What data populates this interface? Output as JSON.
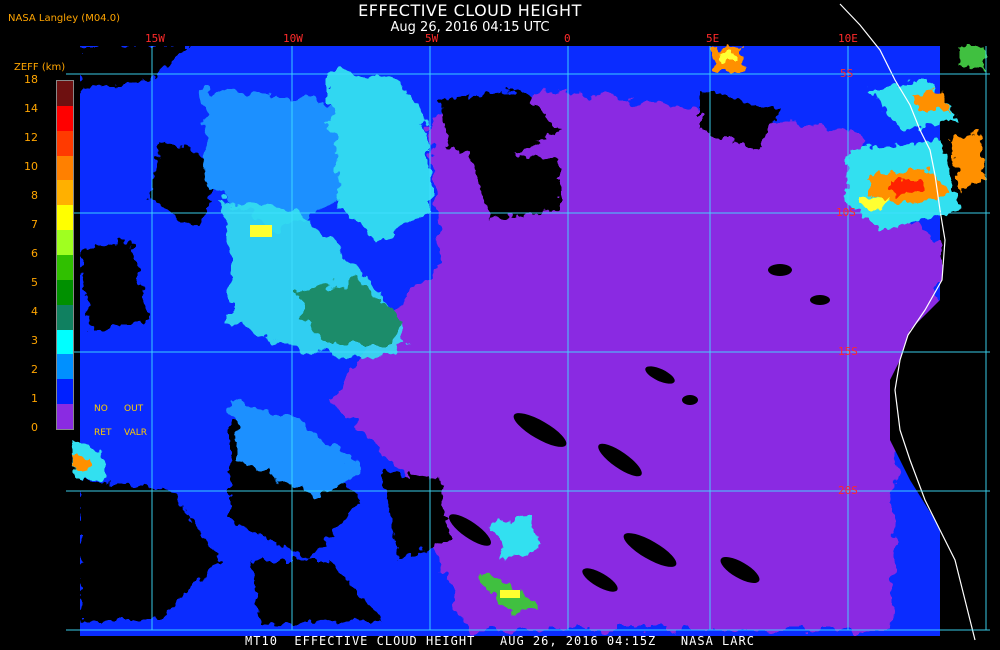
{
  "header": {
    "title": "EFFECTIVE CLOUD HEIGHT",
    "subtitle": "Aug 26, 2016 04:15 UTC",
    "credit": "NASA Langley (M04.0)"
  },
  "footer": {
    "text": "MT10  EFFECTIVE CLOUD HEIGHT   AUG 26, 2016 04:15Z   NASA LARC"
  },
  "map": {
    "lon_labels": [
      "15W",
      "10W",
      "5W",
      "0",
      "5E",
      "10E"
    ],
    "lat_labels": [
      "5S",
      "10S",
      "15S",
      "20S"
    ],
    "grid_color": "#40e0ff",
    "label_color": "#ff2a2a",
    "coast_color": "#ffffff"
  },
  "colorbar": {
    "title": "ZEFF (km)",
    "ticks": [
      "18",
      "14",
      "12",
      "10",
      "8",
      "7",
      "6",
      "5",
      "4",
      "3",
      "2",
      "1",
      "0"
    ],
    "colors": [
      "#6e1010",
      "#ff0000",
      "#ff3a00",
      "#ff8000",
      "#ffb000",
      "#ffff00",
      "#a0ff20",
      "#30c000",
      "#009000",
      "#108060",
      "#00ffff",
      "#0090ff",
      "#0020ff",
      "#8a2be2"
    ],
    "no_retrieval_label_1": "NO",
    "no_retrieval_label_2": "RET",
    "out_label_1": "OUT",
    "out_label_2": "VALR"
  },
  "cloud_colors": {
    "ocean_low": "#8a2be2",
    "low_blue": "#0a2cff",
    "mid_blue": "#1e90ff",
    "cyan": "#33e0f0",
    "teal": "#1e8c6a",
    "green": "#40c040",
    "yellow": "#ffff30",
    "orange": "#ff9000",
    "red": "#ff2000",
    "clear": "#000000"
  }
}
